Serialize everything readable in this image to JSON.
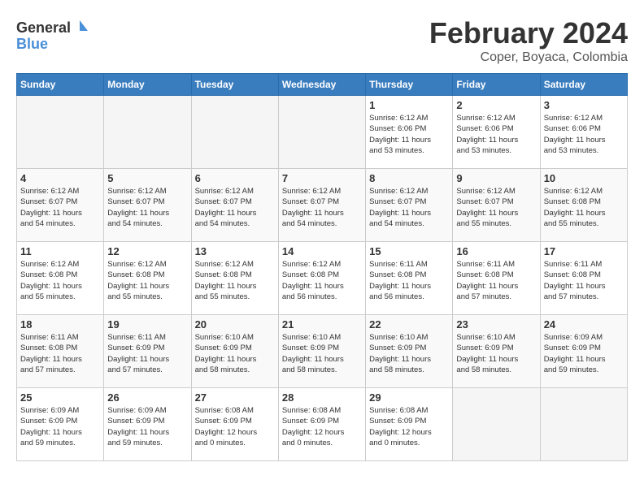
{
  "header": {
    "logo_text_general": "General",
    "logo_text_blue": "Blue",
    "month_year": "February 2024",
    "location": "Coper, Boyaca, Colombia"
  },
  "weekdays": [
    "Sunday",
    "Monday",
    "Tuesday",
    "Wednesday",
    "Thursday",
    "Friday",
    "Saturday"
  ],
  "weeks": [
    [
      {
        "day": "",
        "info": "",
        "empty": true
      },
      {
        "day": "",
        "info": "",
        "empty": true
      },
      {
        "day": "",
        "info": "",
        "empty": true
      },
      {
        "day": "",
        "info": "",
        "empty": true
      },
      {
        "day": "1",
        "info": "Sunrise: 6:12 AM\nSunset: 6:06 PM\nDaylight: 11 hours\nand 53 minutes.",
        "empty": false
      },
      {
        "day": "2",
        "info": "Sunrise: 6:12 AM\nSunset: 6:06 PM\nDaylight: 11 hours\nand 53 minutes.",
        "empty": false
      },
      {
        "day": "3",
        "info": "Sunrise: 6:12 AM\nSunset: 6:06 PM\nDaylight: 11 hours\nand 53 minutes.",
        "empty": false
      }
    ],
    [
      {
        "day": "4",
        "info": "Sunrise: 6:12 AM\nSunset: 6:07 PM\nDaylight: 11 hours\nand 54 minutes.",
        "empty": false
      },
      {
        "day": "5",
        "info": "Sunrise: 6:12 AM\nSunset: 6:07 PM\nDaylight: 11 hours\nand 54 minutes.",
        "empty": false
      },
      {
        "day": "6",
        "info": "Sunrise: 6:12 AM\nSunset: 6:07 PM\nDaylight: 11 hours\nand 54 minutes.",
        "empty": false
      },
      {
        "day": "7",
        "info": "Sunrise: 6:12 AM\nSunset: 6:07 PM\nDaylight: 11 hours\nand 54 minutes.",
        "empty": false
      },
      {
        "day": "8",
        "info": "Sunrise: 6:12 AM\nSunset: 6:07 PM\nDaylight: 11 hours\nand 54 minutes.",
        "empty": false
      },
      {
        "day": "9",
        "info": "Sunrise: 6:12 AM\nSunset: 6:07 PM\nDaylight: 11 hours\nand 55 minutes.",
        "empty": false
      },
      {
        "day": "10",
        "info": "Sunrise: 6:12 AM\nSunset: 6:08 PM\nDaylight: 11 hours\nand 55 minutes.",
        "empty": false
      }
    ],
    [
      {
        "day": "11",
        "info": "Sunrise: 6:12 AM\nSunset: 6:08 PM\nDaylight: 11 hours\nand 55 minutes.",
        "empty": false
      },
      {
        "day": "12",
        "info": "Sunrise: 6:12 AM\nSunset: 6:08 PM\nDaylight: 11 hours\nand 55 minutes.",
        "empty": false
      },
      {
        "day": "13",
        "info": "Sunrise: 6:12 AM\nSunset: 6:08 PM\nDaylight: 11 hours\nand 55 minutes.",
        "empty": false
      },
      {
        "day": "14",
        "info": "Sunrise: 6:12 AM\nSunset: 6:08 PM\nDaylight: 11 hours\nand 56 minutes.",
        "empty": false
      },
      {
        "day": "15",
        "info": "Sunrise: 6:11 AM\nSunset: 6:08 PM\nDaylight: 11 hours\nand 56 minutes.",
        "empty": false
      },
      {
        "day": "16",
        "info": "Sunrise: 6:11 AM\nSunset: 6:08 PM\nDaylight: 11 hours\nand 57 minutes.",
        "empty": false
      },
      {
        "day": "17",
        "info": "Sunrise: 6:11 AM\nSunset: 6:08 PM\nDaylight: 11 hours\nand 57 minutes.",
        "empty": false
      }
    ],
    [
      {
        "day": "18",
        "info": "Sunrise: 6:11 AM\nSunset: 6:08 PM\nDaylight: 11 hours\nand 57 minutes.",
        "empty": false
      },
      {
        "day": "19",
        "info": "Sunrise: 6:11 AM\nSunset: 6:09 PM\nDaylight: 11 hours\nand 57 minutes.",
        "empty": false
      },
      {
        "day": "20",
        "info": "Sunrise: 6:10 AM\nSunset: 6:09 PM\nDaylight: 11 hours\nand 58 minutes.",
        "empty": false
      },
      {
        "day": "21",
        "info": "Sunrise: 6:10 AM\nSunset: 6:09 PM\nDaylight: 11 hours\nand 58 minutes.",
        "empty": false
      },
      {
        "day": "22",
        "info": "Sunrise: 6:10 AM\nSunset: 6:09 PM\nDaylight: 11 hours\nand 58 minutes.",
        "empty": false
      },
      {
        "day": "23",
        "info": "Sunrise: 6:10 AM\nSunset: 6:09 PM\nDaylight: 11 hours\nand 58 minutes.",
        "empty": false
      },
      {
        "day": "24",
        "info": "Sunrise: 6:09 AM\nSunset: 6:09 PM\nDaylight: 11 hours\nand 59 minutes.",
        "empty": false
      }
    ],
    [
      {
        "day": "25",
        "info": "Sunrise: 6:09 AM\nSunset: 6:09 PM\nDaylight: 11 hours\nand 59 minutes.",
        "empty": false
      },
      {
        "day": "26",
        "info": "Sunrise: 6:09 AM\nSunset: 6:09 PM\nDaylight: 11 hours\nand 59 minutes.",
        "empty": false
      },
      {
        "day": "27",
        "info": "Sunrise: 6:08 AM\nSunset: 6:09 PM\nDaylight: 12 hours\nand 0 minutes.",
        "empty": false
      },
      {
        "day": "28",
        "info": "Sunrise: 6:08 AM\nSunset: 6:09 PM\nDaylight: 12 hours\nand 0 minutes.",
        "empty": false
      },
      {
        "day": "29",
        "info": "Sunrise: 6:08 AM\nSunset: 6:09 PM\nDaylight: 12 hours\nand 0 minutes.",
        "empty": false
      },
      {
        "day": "",
        "info": "",
        "empty": true
      },
      {
        "day": "",
        "info": "",
        "empty": true
      }
    ]
  ]
}
